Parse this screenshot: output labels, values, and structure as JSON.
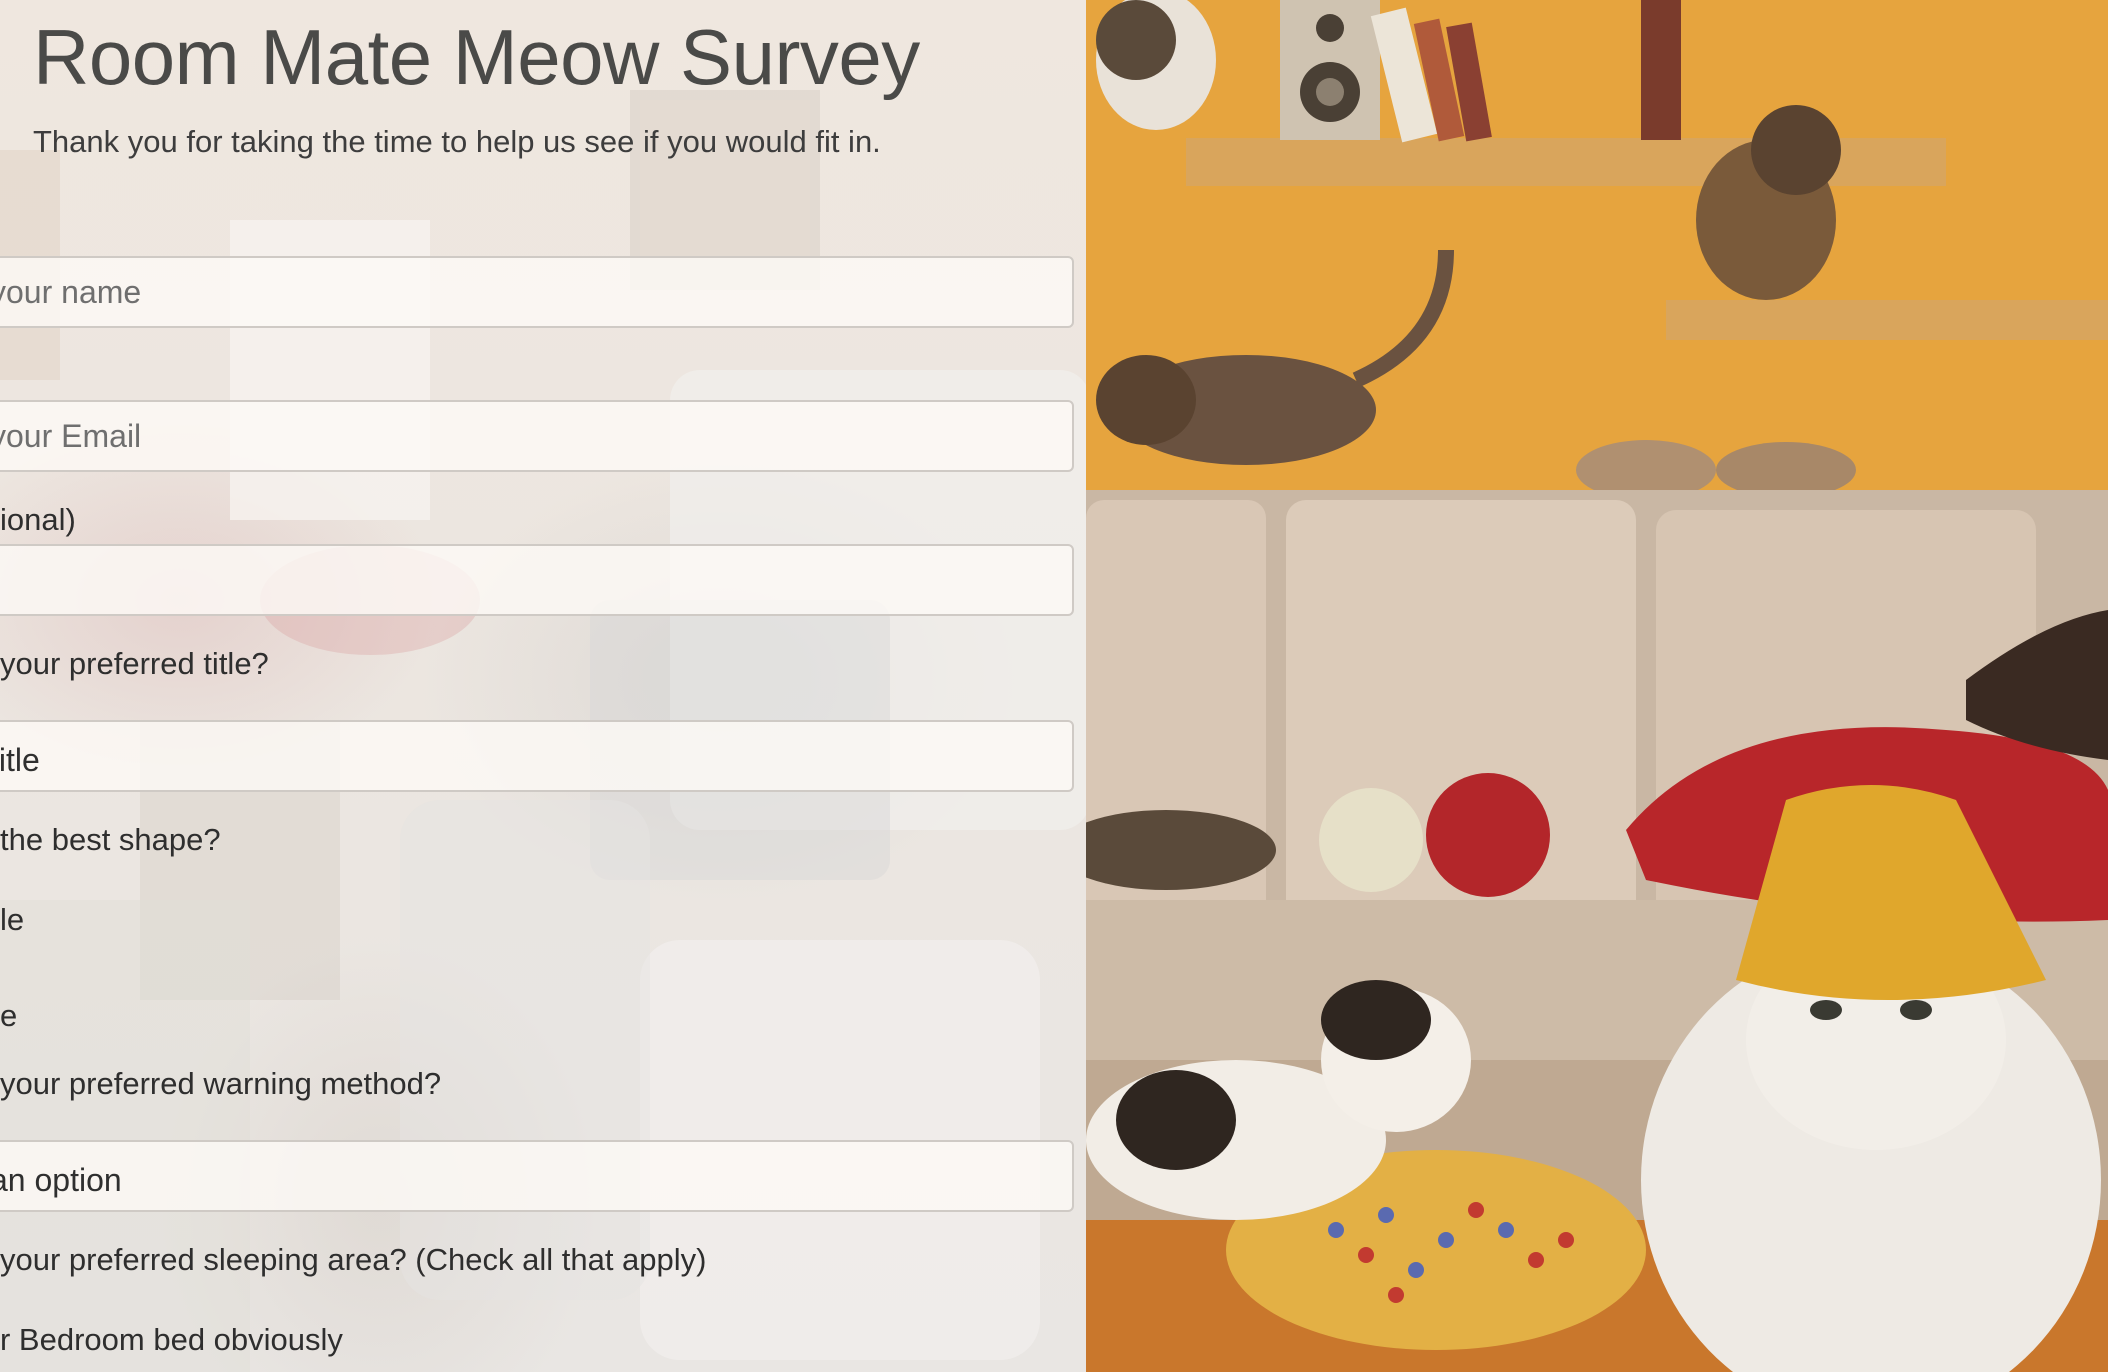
{
  "header": {
    "title": "Room Mate Meow Survey",
    "description": "Thank you for taking the time to help us see if you would fit in."
  },
  "form": {
    "name_placeholder": "your name",
    "email_placeholder": "your Email",
    "age_label": "ional)",
    "age_value": "",
    "title_question": "your preferred title?",
    "title_select_value": " title",
    "shape_question": "the best shape?",
    "shape_options": [
      "le",
      "e"
    ],
    "warning_question": "your preferred warning method?",
    "warning_select_value": " an option",
    "sleeping_question": "your preferred sleeping area? (Check all that apply)",
    "sleeping_options": [
      "r Bedroom bed obviously"
    ]
  },
  "photo": {
    "subject": "cats-in-living-room-photo",
    "colors": {
      "wall": "#e6a43e",
      "sofa": "#d9c7b5",
      "pillow": "#b8262a",
      "lampshade": "#e0a72c",
      "floor": "#c9772c"
    }
  },
  "theme": {
    "text": "#333333",
    "border": "#cfcac5",
    "field_bg": "#fcf9f5"
  }
}
